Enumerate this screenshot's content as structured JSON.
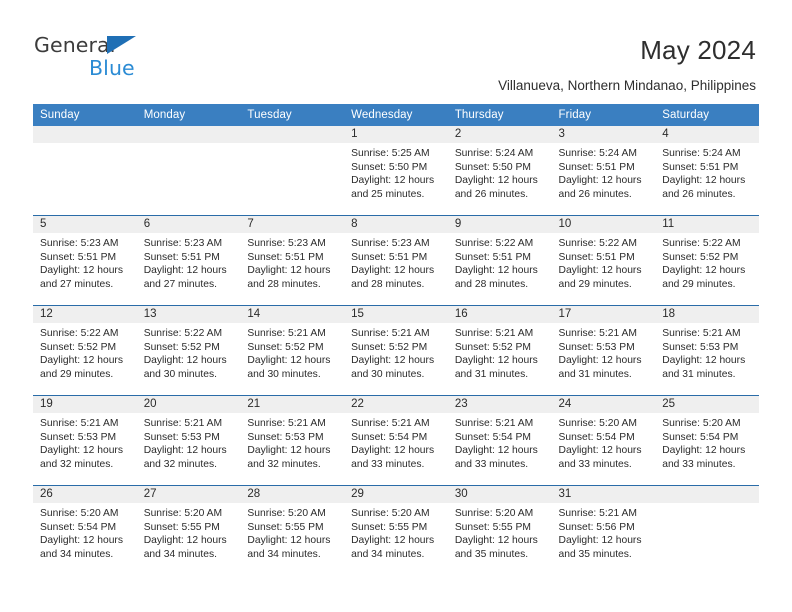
{
  "brand": {
    "name_top": "General",
    "name_bottom": "Blue",
    "accent_color": "#2b8bd4",
    "triangle_color": "#1f6fb5"
  },
  "header": {
    "title": "May 2024",
    "subtitle": "Villanueva, Northern Mindanao, Philippines",
    "header_bg_color": "#3a7fc1",
    "row_divider_color": "#2a6ca8",
    "daynum_strip_color": "#efefef"
  },
  "weekday_headers": [
    "Sunday",
    "Monday",
    "Tuesday",
    "Wednesday",
    "Thursday",
    "Friday",
    "Saturday"
  ],
  "weeks": [
    {
      "days": [
        {
          "num": "",
          "sunrise": "",
          "sunset": "",
          "daylight1": "",
          "daylight2": ""
        },
        {
          "num": "",
          "sunrise": "",
          "sunset": "",
          "daylight1": "",
          "daylight2": ""
        },
        {
          "num": "",
          "sunrise": "",
          "sunset": "",
          "daylight1": "",
          "daylight2": ""
        },
        {
          "num": "1",
          "sunrise": "Sunrise: 5:25 AM",
          "sunset": "Sunset: 5:50 PM",
          "daylight1": "Daylight: 12 hours",
          "daylight2": "and 25 minutes."
        },
        {
          "num": "2",
          "sunrise": "Sunrise: 5:24 AM",
          "sunset": "Sunset: 5:50 PM",
          "daylight1": "Daylight: 12 hours",
          "daylight2": "and 26 minutes."
        },
        {
          "num": "3",
          "sunrise": "Sunrise: 5:24 AM",
          "sunset": "Sunset: 5:51 PM",
          "daylight1": "Daylight: 12 hours",
          "daylight2": "and 26 minutes."
        },
        {
          "num": "4",
          "sunrise": "Sunrise: 5:24 AM",
          "sunset": "Sunset: 5:51 PM",
          "daylight1": "Daylight: 12 hours",
          "daylight2": "and 26 minutes."
        }
      ]
    },
    {
      "days": [
        {
          "num": "5",
          "sunrise": "Sunrise: 5:23 AM",
          "sunset": "Sunset: 5:51 PM",
          "daylight1": "Daylight: 12 hours",
          "daylight2": "and 27 minutes."
        },
        {
          "num": "6",
          "sunrise": "Sunrise: 5:23 AM",
          "sunset": "Sunset: 5:51 PM",
          "daylight1": "Daylight: 12 hours",
          "daylight2": "and 27 minutes."
        },
        {
          "num": "7",
          "sunrise": "Sunrise: 5:23 AM",
          "sunset": "Sunset: 5:51 PM",
          "daylight1": "Daylight: 12 hours",
          "daylight2": "and 28 minutes."
        },
        {
          "num": "8",
          "sunrise": "Sunrise: 5:23 AM",
          "sunset": "Sunset: 5:51 PM",
          "daylight1": "Daylight: 12 hours",
          "daylight2": "and 28 minutes."
        },
        {
          "num": "9",
          "sunrise": "Sunrise: 5:22 AM",
          "sunset": "Sunset: 5:51 PM",
          "daylight1": "Daylight: 12 hours",
          "daylight2": "and 28 minutes."
        },
        {
          "num": "10",
          "sunrise": "Sunrise: 5:22 AM",
          "sunset": "Sunset: 5:51 PM",
          "daylight1": "Daylight: 12 hours",
          "daylight2": "and 29 minutes."
        },
        {
          "num": "11",
          "sunrise": "Sunrise: 5:22 AM",
          "sunset": "Sunset: 5:52 PM",
          "daylight1": "Daylight: 12 hours",
          "daylight2": "and 29 minutes."
        }
      ]
    },
    {
      "days": [
        {
          "num": "12",
          "sunrise": "Sunrise: 5:22 AM",
          "sunset": "Sunset: 5:52 PM",
          "daylight1": "Daylight: 12 hours",
          "daylight2": "and 29 minutes."
        },
        {
          "num": "13",
          "sunrise": "Sunrise: 5:22 AM",
          "sunset": "Sunset: 5:52 PM",
          "daylight1": "Daylight: 12 hours",
          "daylight2": "and 30 minutes."
        },
        {
          "num": "14",
          "sunrise": "Sunrise: 5:21 AM",
          "sunset": "Sunset: 5:52 PM",
          "daylight1": "Daylight: 12 hours",
          "daylight2": "and 30 minutes."
        },
        {
          "num": "15",
          "sunrise": "Sunrise: 5:21 AM",
          "sunset": "Sunset: 5:52 PM",
          "daylight1": "Daylight: 12 hours",
          "daylight2": "and 30 minutes."
        },
        {
          "num": "16",
          "sunrise": "Sunrise: 5:21 AM",
          "sunset": "Sunset: 5:52 PM",
          "daylight1": "Daylight: 12 hours",
          "daylight2": "and 31 minutes."
        },
        {
          "num": "17",
          "sunrise": "Sunrise: 5:21 AM",
          "sunset": "Sunset: 5:53 PM",
          "daylight1": "Daylight: 12 hours",
          "daylight2": "and 31 minutes."
        },
        {
          "num": "18",
          "sunrise": "Sunrise: 5:21 AM",
          "sunset": "Sunset: 5:53 PM",
          "daylight1": "Daylight: 12 hours",
          "daylight2": "and 31 minutes."
        }
      ]
    },
    {
      "days": [
        {
          "num": "19",
          "sunrise": "Sunrise: 5:21 AM",
          "sunset": "Sunset: 5:53 PM",
          "daylight1": "Daylight: 12 hours",
          "daylight2": "and 32 minutes."
        },
        {
          "num": "20",
          "sunrise": "Sunrise: 5:21 AM",
          "sunset": "Sunset: 5:53 PM",
          "daylight1": "Daylight: 12 hours",
          "daylight2": "and 32 minutes."
        },
        {
          "num": "21",
          "sunrise": "Sunrise: 5:21 AM",
          "sunset": "Sunset: 5:53 PM",
          "daylight1": "Daylight: 12 hours",
          "daylight2": "and 32 minutes."
        },
        {
          "num": "22",
          "sunrise": "Sunrise: 5:21 AM",
          "sunset": "Sunset: 5:54 PM",
          "daylight1": "Daylight: 12 hours",
          "daylight2": "and 33 minutes."
        },
        {
          "num": "23",
          "sunrise": "Sunrise: 5:21 AM",
          "sunset": "Sunset: 5:54 PM",
          "daylight1": "Daylight: 12 hours",
          "daylight2": "and 33 minutes."
        },
        {
          "num": "24",
          "sunrise": "Sunrise: 5:20 AM",
          "sunset": "Sunset: 5:54 PM",
          "daylight1": "Daylight: 12 hours",
          "daylight2": "and 33 minutes."
        },
        {
          "num": "25",
          "sunrise": "Sunrise: 5:20 AM",
          "sunset": "Sunset: 5:54 PM",
          "daylight1": "Daylight: 12 hours",
          "daylight2": "and 33 minutes."
        }
      ]
    },
    {
      "days": [
        {
          "num": "26",
          "sunrise": "Sunrise: 5:20 AM",
          "sunset": "Sunset: 5:54 PM",
          "daylight1": "Daylight: 12 hours",
          "daylight2": "and 34 minutes."
        },
        {
          "num": "27",
          "sunrise": "Sunrise: 5:20 AM",
          "sunset": "Sunset: 5:55 PM",
          "daylight1": "Daylight: 12 hours",
          "daylight2": "and 34 minutes."
        },
        {
          "num": "28",
          "sunrise": "Sunrise: 5:20 AM",
          "sunset": "Sunset: 5:55 PM",
          "daylight1": "Daylight: 12 hours",
          "daylight2": "and 34 minutes."
        },
        {
          "num": "29",
          "sunrise": "Sunrise: 5:20 AM",
          "sunset": "Sunset: 5:55 PM",
          "daylight1": "Daylight: 12 hours",
          "daylight2": "and 34 minutes."
        },
        {
          "num": "30",
          "sunrise": "Sunrise: 5:20 AM",
          "sunset": "Sunset: 5:55 PM",
          "daylight1": "Daylight: 12 hours",
          "daylight2": "and 35 minutes."
        },
        {
          "num": "31",
          "sunrise": "Sunrise: 5:21 AM",
          "sunset": "Sunset: 5:56 PM",
          "daylight1": "Daylight: 12 hours",
          "daylight2": "and 35 minutes."
        },
        {
          "num": "",
          "sunrise": "",
          "sunset": "",
          "daylight1": "",
          "daylight2": ""
        }
      ]
    }
  ]
}
